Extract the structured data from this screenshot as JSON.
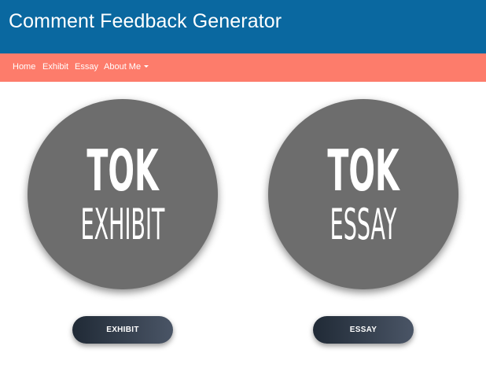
{
  "header": {
    "title": "Comment Feedback Generator"
  },
  "nav": {
    "items": [
      {
        "label": "Home"
      },
      {
        "label": "Exhibit"
      },
      {
        "label": "Essay"
      },
      {
        "label": "About Me",
        "has_dropdown": true
      }
    ]
  },
  "cards": [
    {
      "line1": "TOK",
      "line2": "EXHIBIT",
      "button_label": "EXHIBIT"
    },
    {
      "line1": "TOK",
      "line2": "ESSAY",
      "button_label": "ESSAY"
    }
  ],
  "colors": {
    "header_bg": "#0a68a0",
    "nav_bg": "#fd7c6b",
    "circle_bg": "#6d6d6d",
    "button_gradient_start": "#202a36",
    "button_gradient_end": "#4a5566"
  }
}
